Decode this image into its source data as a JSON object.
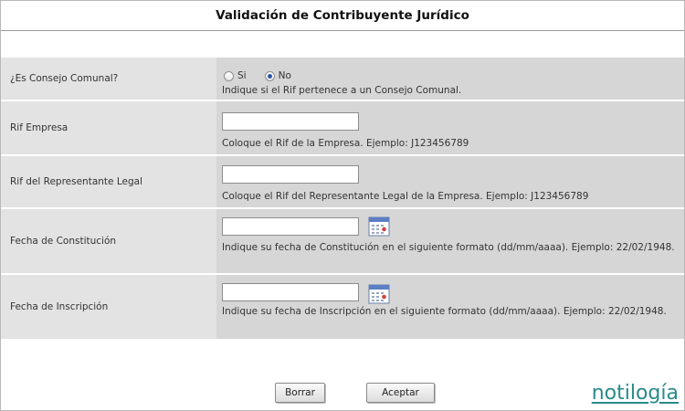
{
  "title": "Validación de Contribuyente Jurídico",
  "rows": {
    "consejo": {
      "label": "¿Es Consejo Comunal?",
      "options": [
        {
          "label": "Si",
          "selected": false
        },
        {
          "label": "No",
          "selected": true
        }
      ],
      "hint": "Indique si el Rif pertenece a un Consejo Comunal."
    },
    "rif_empresa": {
      "label": "Rif Empresa",
      "value": "",
      "hint": "Coloque el Rif de la Empresa. Ejemplo: J123456789"
    },
    "rif_representante": {
      "label": "Rif del Representante Legal",
      "value": "",
      "hint": "Coloque el Rif del Representante Legal de la Empresa. Ejemplo: J123456789"
    },
    "fecha_constitucion": {
      "label": "Fecha de Constitución",
      "value": "",
      "hint": "Indique su fecha de Constitución en el siguiente formato (dd/mm/aaaa). Ejemplo: 22/02/1948."
    },
    "fecha_inscripcion": {
      "label": "Fecha de Inscripción",
      "value": "",
      "hint": "Indique su fecha de Inscripción en el siguiente formato (dd/mm/aaaa). Ejemplo: 22/02/1948."
    }
  },
  "buttons": {
    "clear_label": "Borrar",
    "accept_label": "Aceptar"
  },
  "watermark": "notilogía"
}
